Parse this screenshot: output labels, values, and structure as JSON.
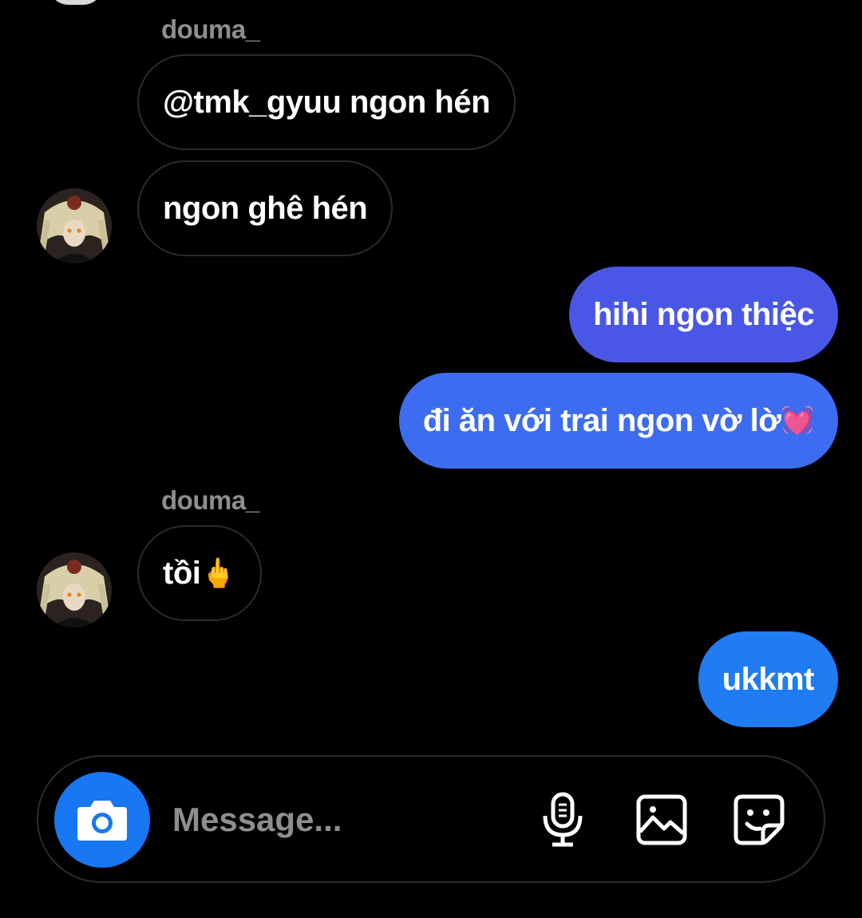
{
  "colors": {
    "background": "#000000",
    "incoming_border": "#2b2b2b",
    "outgoing_purple": "#4a57e6",
    "outgoing_blue": "#3d6cf0",
    "outgoing_light_blue": "#1f7cf2",
    "camera_button": "#1877f2",
    "secondary_text": "#8e8e8e"
  },
  "messages": [
    {
      "sender": "douma_",
      "text": "@tmk_gyuu ngon hén",
      "direction": "incoming"
    },
    {
      "text": "ngon ghê hén",
      "direction": "incoming",
      "avatar_icon": "user-avatar"
    },
    {
      "text": "hihi ngon thiệc",
      "direction": "outgoing"
    },
    {
      "text": "đi ăn với trai ngon vờ lờ",
      "emoji": "💓",
      "direction": "outgoing"
    },
    {
      "sender": "douma_",
      "text": "tồi",
      "emoji": "🖕",
      "direction": "incoming",
      "avatar_icon": "user-avatar"
    },
    {
      "text": "ukkmt",
      "direction": "outgoing"
    }
  ],
  "composer": {
    "placeholder": "Message...",
    "value": "",
    "icons": [
      "camera-icon",
      "microphone-icon",
      "gallery-icon",
      "sticker-icon"
    ]
  }
}
